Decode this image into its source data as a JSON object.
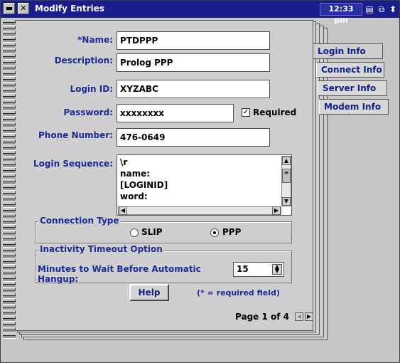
{
  "window": {
    "title": "Modify Entries",
    "clock": "12:33 pm"
  },
  "tabs": [
    {
      "label": "Login Info",
      "active": true
    },
    {
      "label": "Connect Info",
      "active": false
    },
    {
      "label": "Server Info",
      "active": false
    },
    {
      "label": "Modem Info",
      "active": false
    }
  ],
  "form": {
    "name_label": "*Name:",
    "name_value": "PTDPPP",
    "description_label": "Description:",
    "description_value": "Prolog PPP",
    "login_id_label": "Login ID:",
    "login_id_value": "XYZABC",
    "password_label": "Password:",
    "password_value": "xxxxxxxx",
    "required_label": "Required",
    "required_checked": true,
    "phone_label": "Phone Number:",
    "phone_value": "476-0649",
    "login_sequence_label": "Login Sequence:",
    "login_sequence_lines": [
      "\\r",
      "name:",
      "[LOGINID]",
      "word:"
    ]
  },
  "connection_type": {
    "title": "Connection Type",
    "options": [
      "SLIP",
      "PPP"
    ],
    "selected": "PPP"
  },
  "inactivity": {
    "title": "Inactivity Timeout Option",
    "label": "Minutes to Wait Before Automatic Hangup:",
    "value": "15"
  },
  "footer": {
    "help_label": "Help",
    "required_note": "(* = required field)",
    "page_text": "Page 1 of 4"
  },
  "colors": {
    "title_bar": "#1a1d8e",
    "label_blue": "#1c2a9a"
  }
}
